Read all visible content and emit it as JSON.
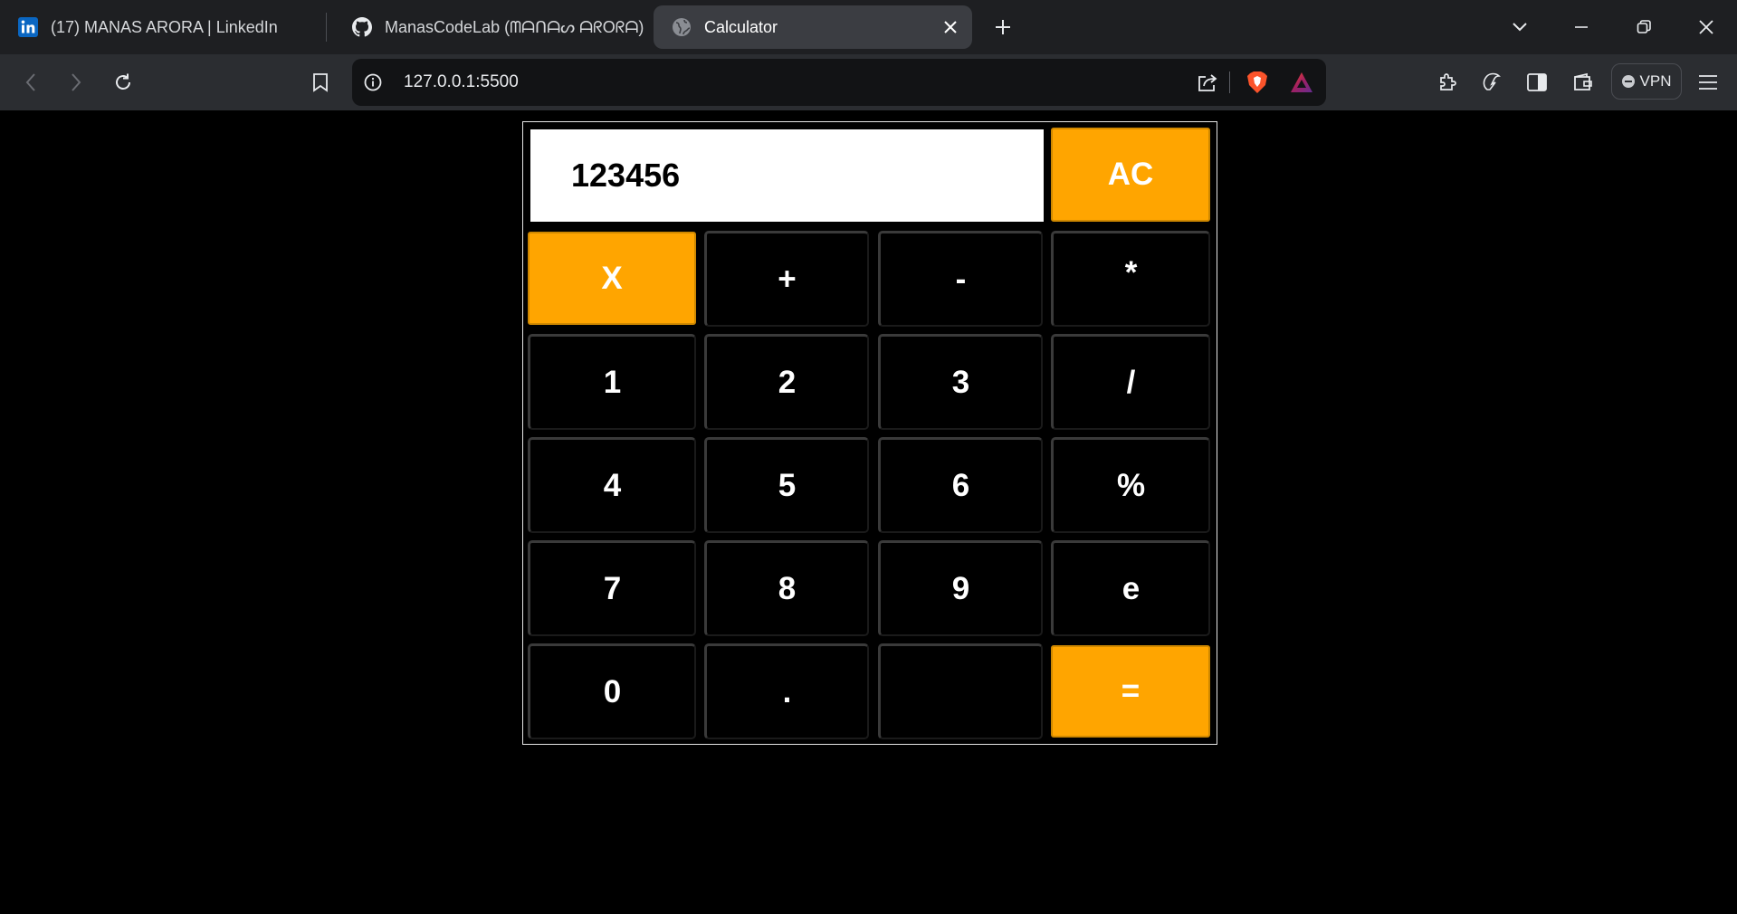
{
  "browser": {
    "tabs": [
      {
        "title": "(17) MANAS ARORA | LinkedIn",
        "icon": "linkedin-icon",
        "active": false
      },
      {
        "title": "ManasCodeLab (ᗰᗩᑎᗩᔕ ᗩᖇOᖇᗩ)",
        "icon": "github-icon",
        "active": false
      },
      {
        "title": "Calculator",
        "icon": "globe-icon",
        "active": true
      }
    ],
    "address_bar": {
      "url": "127.0.0.1:5500"
    },
    "vpn_label": "VPN",
    "colors": {
      "tabstrip": "#1e1f22",
      "toolbar": "#2b2d31",
      "active_tab": "#3b3d42",
      "omnibox": "#121315"
    }
  },
  "calculator": {
    "display_value": "123456",
    "keys": [
      {
        "label": "AC",
        "name": "key-ac",
        "style": "orange"
      },
      {
        "label": "X",
        "name": "key-backspace",
        "style": "orange"
      },
      {
        "label": "+",
        "name": "key-add",
        "style": "dark"
      },
      {
        "label": "-",
        "name": "key-subtract",
        "style": "dark"
      },
      {
        "label": "*",
        "name": "key-multiply",
        "style": "dark"
      },
      {
        "label": "1",
        "name": "key-1",
        "style": "dark"
      },
      {
        "label": "2",
        "name": "key-2",
        "style": "dark"
      },
      {
        "label": "3",
        "name": "key-3",
        "style": "dark"
      },
      {
        "label": "/",
        "name": "key-divide",
        "style": "dark"
      },
      {
        "label": "4",
        "name": "key-4",
        "style": "dark"
      },
      {
        "label": "5",
        "name": "key-5",
        "style": "dark"
      },
      {
        "label": "6",
        "name": "key-6",
        "style": "dark"
      },
      {
        "label": "%",
        "name": "key-percent",
        "style": "dark"
      },
      {
        "label": "7",
        "name": "key-7",
        "style": "dark"
      },
      {
        "label": "8",
        "name": "key-8",
        "style": "dark"
      },
      {
        "label": "9",
        "name": "key-9",
        "style": "dark"
      },
      {
        "label": "e",
        "name": "key-e",
        "style": "dark"
      },
      {
        "label": "0",
        "name": "key-0",
        "style": "dark"
      },
      {
        "label": ".",
        "name": "key-decimal",
        "style": "dark"
      },
      {
        "label": "",
        "name": "key-blank",
        "style": "dark"
      },
      {
        "label": "=",
        "name": "key-equals",
        "style": "orange"
      }
    ],
    "colors": {
      "accent": "#ffa500",
      "key_background": "#000000",
      "key_text": "#ffffff",
      "display_background": "#ffffff",
      "page_background": "#000000"
    }
  }
}
